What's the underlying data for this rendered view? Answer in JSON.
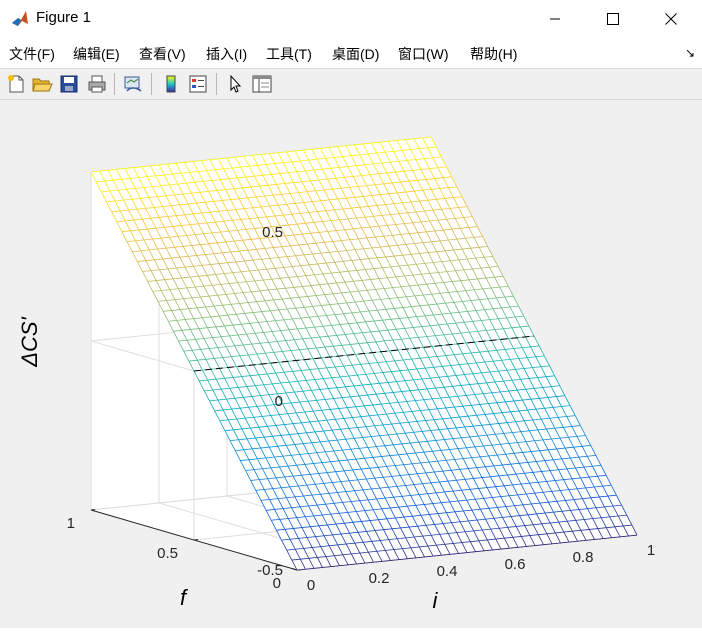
{
  "window": {
    "title": "Figure 1"
  },
  "menu": {
    "items": [
      "文件(F)",
      "编辑(E)",
      "查看(V)",
      "插入(I)",
      "工具(T)",
      "桌面(D)",
      "窗口(W)",
      "帮助(H)"
    ]
  },
  "toolbar": {
    "icons": [
      "new-figure-icon",
      "open-file-icon",
      "save-icon",
      "print-icon",
      "link-plot-icon",
      "insert-colorbar-icon",
      "insert-legend-icon",
      "pointer-icon",
      "property-inspector-icon"
    ]
  },
  "chart_data": {
    "type": "surface",
    "xlabel": "i",
    "ylabel": "f",
    "zlabel": "ΔCS'",
    "xticks": [
      "0",
      "0.2",
      "0.4",
      "0.6",
      "0.8",
      "1"
    ],
    "yticks": [
      "0",
      "0.5",
      "1"
    ],
    "zticks": [
      "-0.5",
      "0",
      "0.5"
    ],
    "xlim": [
      0,
      1
    ],
    "ylim": [
      0,
      1
    ],
    "zlim": [
      -0.5,
      0.5
    ],
    "grid": true,
    "colormap": "parula",
    "surface": {
      "z_at_f0": -0.5,
      "z_at_f1": 0.5,
      "grid_lines_i": 41,
      "grid_lines_f": 41,
      "depends_on": "f"
    },
    "contour_line": {
      "z": 0,
      "style": "dashed",
      "color": "#000000"
    }
  }
}
